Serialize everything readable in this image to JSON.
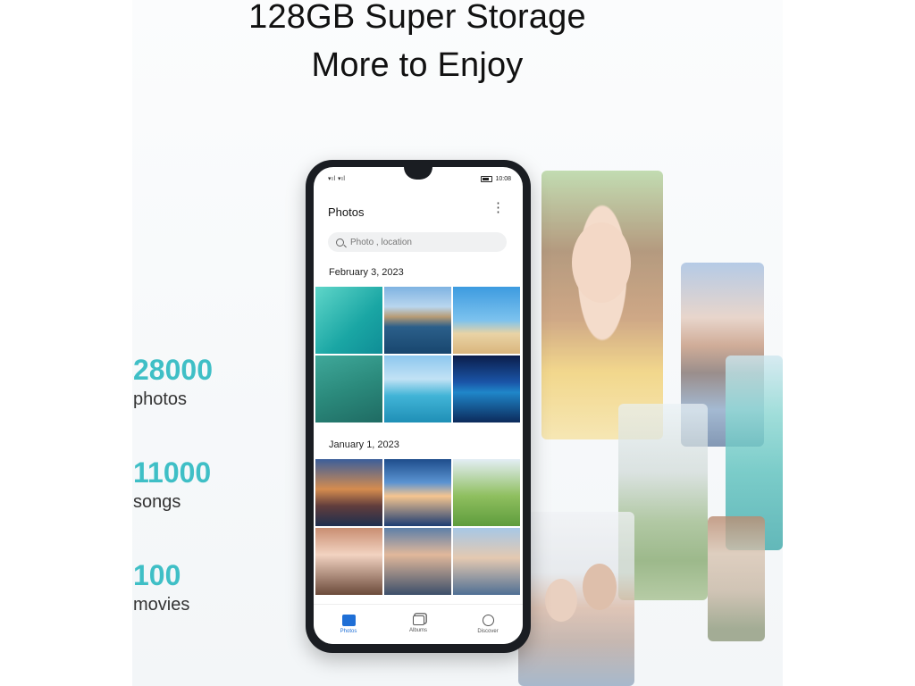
{
  "headline": {
    "line1": "128GB Super Storage",
    "line2": "More to Enjoy"
  },
  "stats": [
    {
      "number": "28000",
      "label": "photos"
    },
    {
      "number": "11000",
      "label": "songs"
    },
    {
      "number": "100",
      "label": "movies"
    }
  ],
  "phone": {
    "status_time": "10:08",
    "app_title": "Photos",
    "search_placeholder": "Photo , location",
    "sections": [
      {
        "date": "February 3, 2023"
      },
      {
        "date": "January 1, 2023"
      }
    ],
    "nav": [
      {
        "label": "Photos",
        "icon": "photos-icon",
        "active": true
      },
      {
        "label": "Albums",
        "icon": "albums-icon",
        "active": false
      },
      {
        "label": "Discover",
        "icon": "discover-icon",
        "active": false
      }
    ],
    "accent_color": "#1f6fd6"
  },
  "colors": {
    "stat_number": "#3fbfc6"
  }
}
